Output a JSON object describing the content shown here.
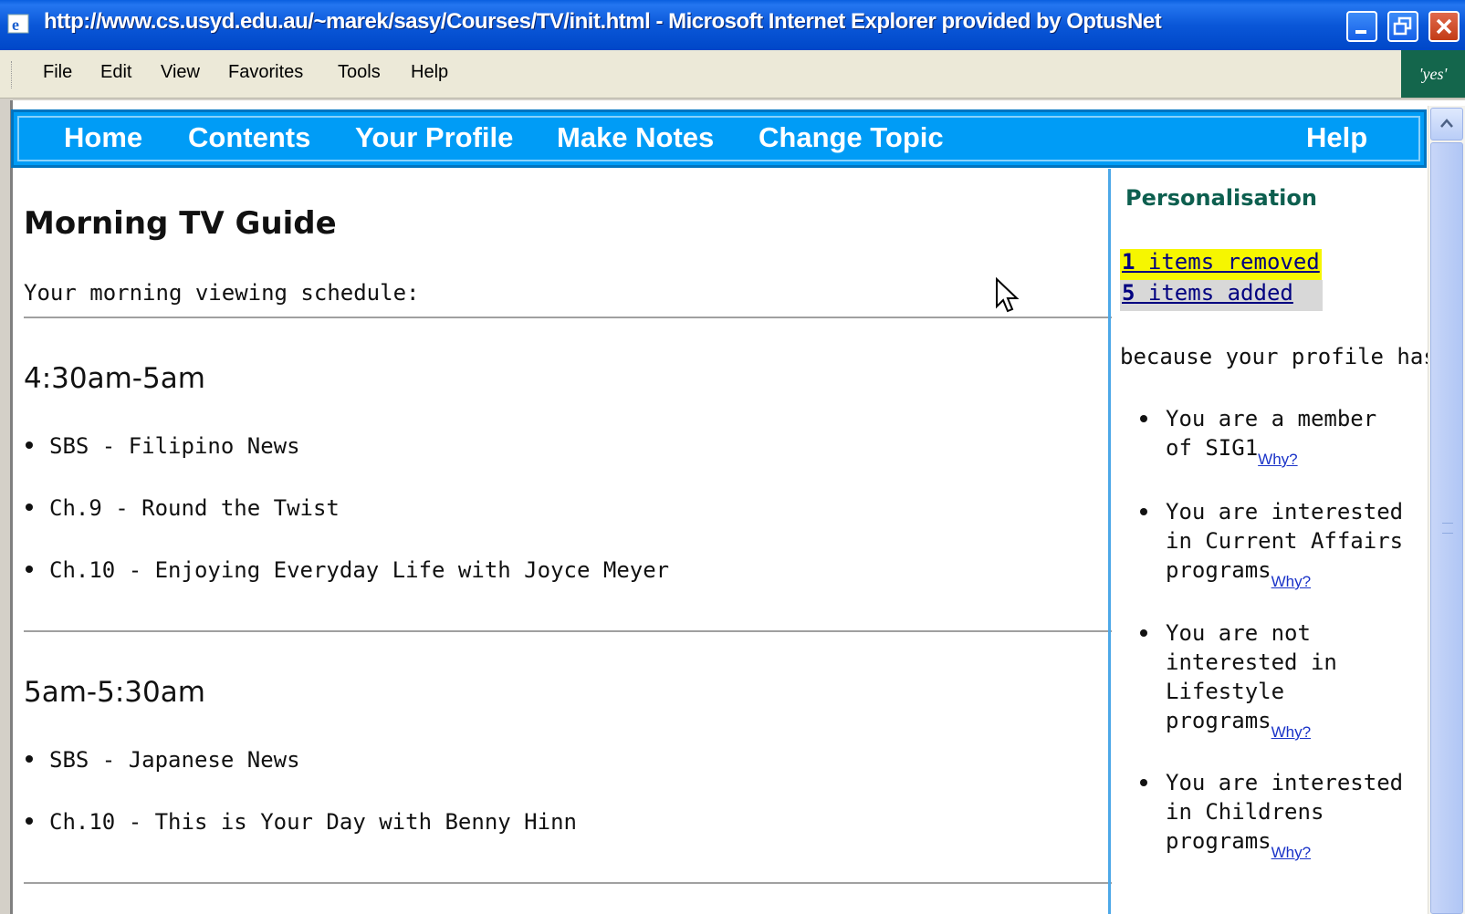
{
  "window": {
    "title": "http://www.cs.usyd.edu.au/~marek/sasy/Courses/TV/init.html - Microsoft Internet Explorer provided by OptusNet"
  },
  "menubar": {
    "items": [
      "File",
      "Edit",
      "View",
      "Favorites",
      "Tools",
      "Help"
    ],
    "brand": "'yes'"
  },
  "nav": {
    "items": [
      "Home",
      "Contents",
      "Your Profile",
      "Make Notes",
      "Change Topic"
    ],
    "help": "Help"
  },
  "main": {
    "title": "Morning TV Guide",
    "intro": "Your morning viewing schedule:",
    "slots": [
      {
        "time": "4:30am-5am",
        "programs": [
          "SBS - Filipino News",
          "Ch.9 - Round the Twist",
          "Ch.10 - Enjoying Everyday Life with Joyce Meyer"
        ]
      },
      {
        "time": "5am-5:30am",
        "programs": [
          "SBS - Japanese News",
          "Ch.10 - This is Your Day with Benny Hinn"
        ]
      }
    ]
  },
  "sidebar": {
    "title": "Personalisation",
    "removed": {
      "count": "1",
      "label": " items removed"
    },
    "added": {
      "count": "5",
      "label": " items added"
    },
    "because": "because your profile has:",
    "why_label": "Why?",
    "reasons": [
      [
        "You are a member",
        "of SIG1"
      ],
      [
        "You are interested",
        "in Current Affairs",
        "programs"
      ],
      [
        "You are not",
        "interested in",
        "Lifestyle",
        "programs"
      ],
      [
        "You are interested",
        "in Childrens",
        "programs"
      ]
    ]
  },
  "colors": {
    "nav_bg": "#009cf6",
    "sidebar_title": "#0d5f4f",
    "removed_highlight": "#f6f600",
    "added_highlight": "#d8d8d8",
    "link": "#1a33c8"
  }
}
